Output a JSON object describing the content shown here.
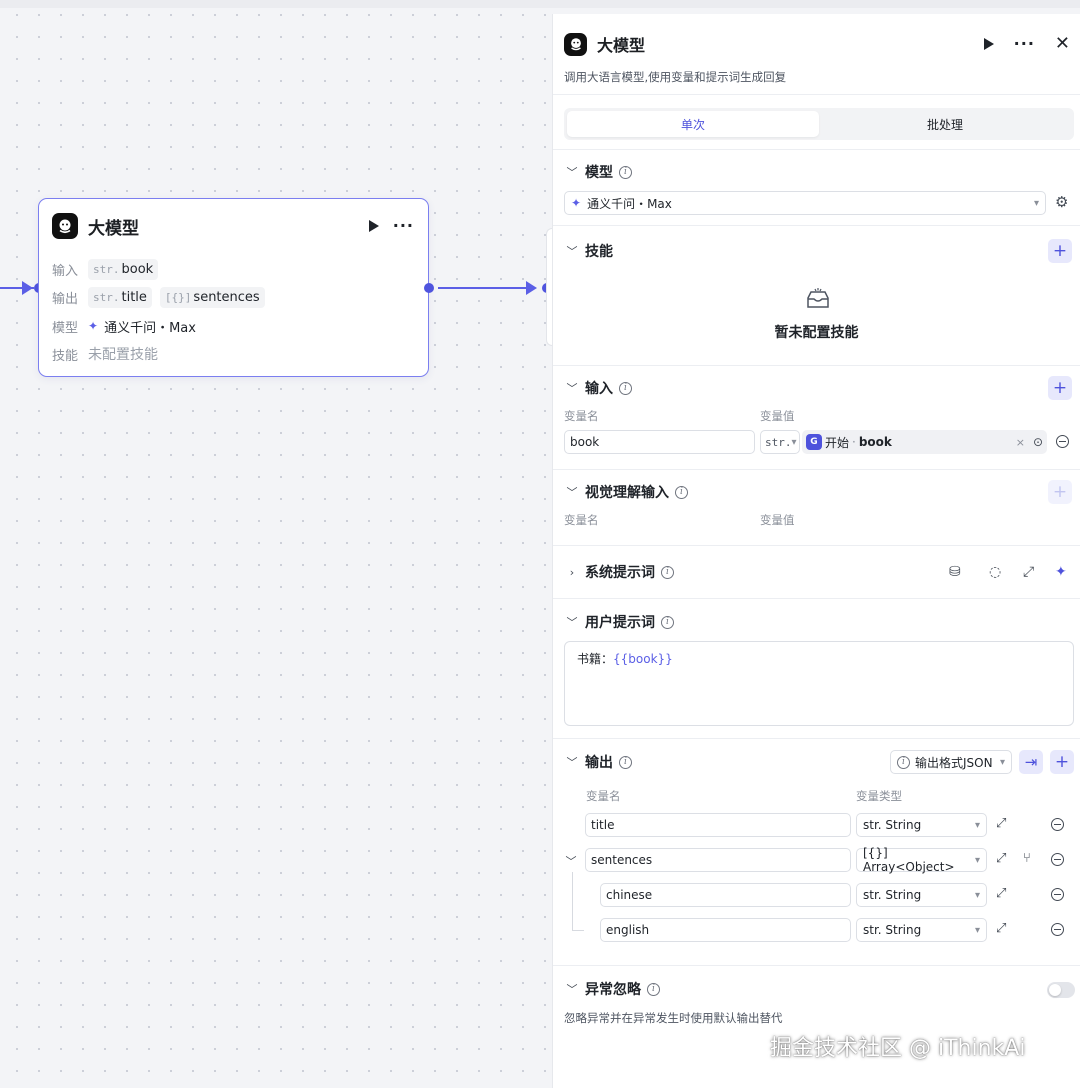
{
  "node": {
    "title": "大模型",
    "input_label": "输入",
    "input_tags": [
      {
        "type": "str.",
        "name": "book"
      }
    ],
    "output_label": "输出",
    "output_tags": [
      {
        "type": "str.",
        "name": "title"
      },
      {
        "type": "[{}]",
        "name": "sentences"
      }
    ],
    "model_label": "模型",
    "model_value": "通义千问・Max",
    "skill_label": "技能",
    "skill_value": "未配置技能"
  },
  "panel": {
    "title": "大模型",
    "description": "调用大语言模型,使用变量和提示词生成回复",
    "tabs": [
      "单次",
      "批处理"
    ],
    "active_tab": "单次",
    "model": {
      "title": "模型",
      "value": "通义千问・Max"
    },
    "skills": {
      "title": "技能",
      "empty_text": "暂未配置技能"
    },
    "inputs": {
      "title": "输入",
      "col_name": "变量名",
      "col_value": "变量值",
      "rows": [
        {
          "name": "book",
          "type": "str.",
          "ref_node": "开始",
          "ref_var": "book"
        }
      ]
    },
    "vision": {
      "title": "视觉理解输入",
      "col_name": "变量名",
      "col_value": "变量值"
    },
    "system_prompt": {
      "title": "系统提示词"
    },
    "user_prompt": {
      "title": "用户提示词",
      "prefix": "书籍：",
      "variable": "{{book}}"
    },
    "output": {
      "title": "输出",
      "format": "输出格式JSON",
      "col_name": "变量名",
      "col_type": "变量类型",
      "rows": [
        {
          "name": "title",
          "type": "str. String"
        },
        {
          "name": "sentences",
          "type": "[{}] Array<Object>"
        },
        {
          "name": "chinese",
          "type": "str. String"
        },
        {
          "name": "english",
          "type": "str. String"
        }
      ]
    },
    "exception": {
      "title": "异常忽略",
      "description": "忽略异常并在异常发生时使用默认输出替代",
      "enabled": false
    }
  },
  "watermark": "掘金技术社区 @ iThinkAi",
  "colors": {
    "accent": "#4e52dc",
    "edge": "#5b5fe6",
    "node_border": "#7b7ff0"
  },
  "icons": [
    "bot-logo-icon",
    "play-icon",
    "more-icon",
    "close-icon",
    "info-icon",
    "plus-icon",
    "settings-icon",
    "clear-icon",
    "target-icon",
    "remove-icon",
    "expand-icon",
    "bulb-icon",
    "sparkle-icon",
    "library-icon",
    "import-icon",
    "add-child-icon",
    "chevron-down-icon",
    "chevron-right-icon"
  ]
}
